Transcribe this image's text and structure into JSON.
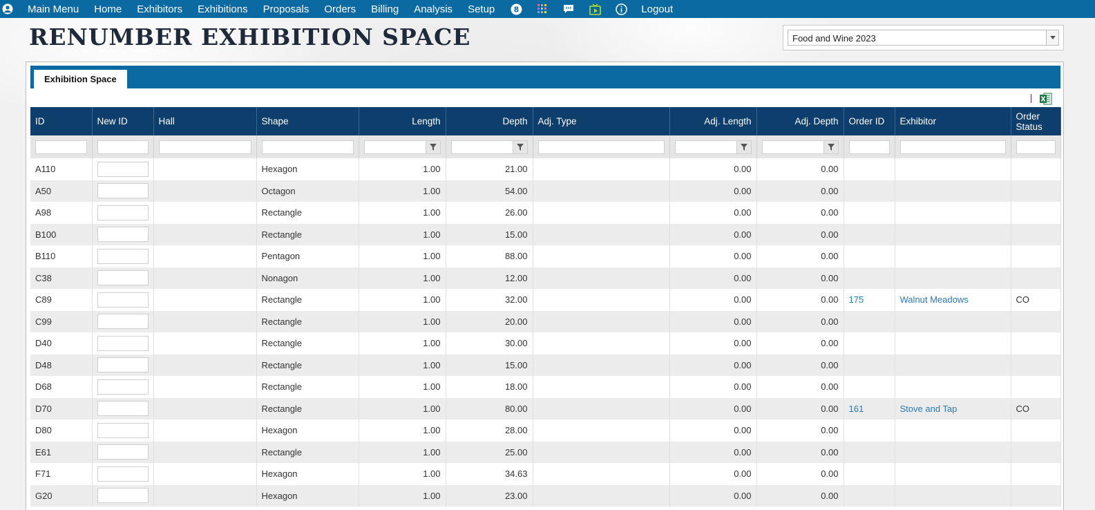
{
  "nav": {
    "items": [
      "Main Menu",
      "Home",
      "Exhibitors",
      "Exhibitions",
      "Proposals",
      "Orders",
      "Billing",
      "Analysis",
      "Setup"
    ],
    "badge": "8",
    "logout": "Logout"
  },
  "header": {
    "title": "RENUMBER EXHIBITION SPACE",
    "exhibition_selected": "Food and Wine 2023"
  },
  "tabs": [
    {
      "label": "Exhibition Space"
    }
  ],
  "grid": {
    "columns": [
      {
        "label": "ID"
      },
      {
        "label": "New ID"
      },
      {
        "label": "Hall"
      },
      {
        "label": "Shape"
      },
      {
        "label": "Length"
      },
      {
        "label": "Depth"
      },
      {
        "label": "Adj. Type"
      },
      {
        "label": "Adj. Length"
      },
      {
        "label": "Adj. Depth"
      },
      {
        "label": "Order ID"
      },
      {
        "label": "Exhibitor"
      },
      {
        "label": "Order Status"
      }
    ],
    "rows": [
      {
        "id": "A110",
        "hall": "",
        "shape": "Hexagon",
        "length": "1.00",
        "depth": "21.00",
        "adj_type": "",
        "adj_length": "0.00",
        "adj_depth": "0.00",
        "order_id": "",
        "exhibitor": "",
        "status": ""
      },
      {
        "id": "A50",
        "hall": "",
        "shape": "Octagon",
        "length": "1.00",
        "depth": "54.00",
        "adj_type": "",
        "adj_length": "0.00",
        "adj_depth": "0.00",
        "order_id": "",
        "exhibitor": "",
        "status": ""
      },
      {
        "id": "A98",
        "hall": "",
        "shape": "Rectangle",
        "length": "1.00",
        "depth": "26.00",
        "adj_type": "",
        "adj_length": "0.00",
        "adj_depth": "0.00",
        "order_id": "",
        "exhibitor": "",
        "status": ""
      },
      {
        "id": "B100",
        "hall": "",
        "shape": "Rectangle",
        "length": "1.00",
        "depth": "15.00",
        "adj_type": "",
        "adj_length": "0.00",
        "adj_depth": "0.00",
        "order_id": "",
        "exhibitor": "",
        "status": ""
      },
      {
        "id": "B110",
        "hall": "",
        "shape": "Pentagon",
        "length": "1.00",
        "depth": "88.00",
        "adj_type": "",
        "adj_length": "0.00",
        "adj_depth": "0.00",
        "order_id": "",
        "exhibitor": "",
        "status": ""
      },
      {
        "id": "C38",
        "hall": "",
        "shape": "Nonagon",
        "length": "1.00",
        "depth": "12.00",
        "adj_type": "",
        "adj_length": "0.00",
        "adj_depth": "0.00",
        "order_id": "",
        "exhibitor": "",
        "status": ""
      },
      {
        "id": "C89",
        "hall": "",
        "shape": "Rectangle",
        "length": "1.00",
        "depth": "32.00",
        "adj_type": "",
        "adj_length": "0.00",
        "adj_depth": "0.00",
        "order_id": "175",
        "exhibitor": "Walnut Meadows",
        "status": "CO"
      },
      {
        "id": "C99",
        "hall": "",
        "shape": "Rectangle",
        "length": "1.00",
        "depth": "20.00",
        "adj_type": "",
        "adj_length": "0.00",
        "adj_depth": "0.00",
        "order_id": "",
        "exhibitor": "",
        "status": ""
      },
      {
        "id": "D40",
        "hall": "",
        "shape": "Rectangle",
        "length": "1.00",
        "depth": "30.00",
        "adj_type": "",
        "adj_length": "0.00",
        "adj_depth": "0.00",
        "order_id": "",
        "exhibitor": "",
        "status": ""
      },
      {
        "id": "D48",
        "hall": "",
        "shape": "Rectangle",
        "length": "1.00",
        "depth": "15.00",
        "adj_type": "",
        "adj_length": "0.00",
        "adj_depth": "0.00",
        "order_id": "",
        "exhibitor": "",
        "status": ""
      },
      {
        "id": "D68",
        "hall": "",
        "shape": "Rectangle",
        "length": "1.00",
        "depth": "18.00",
        "adj_type": "",
        "adj_length": "0.00",
        "adj_depth": "0.00",
        "order_id": "",
        "exhibitor": "",
        "status": ""
      },
      {
        "id": "D70",
        "hall": "",
        "shape": "Rectangle",
        "length": "1.00",
        "depth": "80.00",
        "adj_type": "",
        "adj_length": "0.00",
        "adj_depth": "0.00",
        "order_id": "161",
        "exhibitor": "Stove and Tap",
        "status": "CO"
      },
      {
        "id": "D80",
        "hall": "",
        "shape": "Hexagon",
        "length": "1.00",
        "depth": "28.00",
        "adj_type": "",
        "adj_length": "0.00",
        "adj_depth": "0.00",
        "order_id": "",
        "exhibitor": "",
        "status": ""
      },
      {
        "id": "E61",
        "hall": "",
        "shape": "Rectangle",
        "length": "1.00",
        "depth": "25.00",
        "adj_type": "",
        "adj_length": "0.00",
        "adj_depth": "0.00",
        "order_id": "",
        "exhibitor": "",
        "status": ""
      },
      {
        "id": "F71",
        "hall": "",
        "shape": "Hexagon",
        "length": "1.00",
        "depth": "34.63",
        "adj_type": "",
        "adj_length": "0.00",
        "adj_depth": "0.00",
        "order_id": "",
        "exhibitor": "",
        "status": ""
      },
      {
        "id": "G20",
        "hall": "",
        "shape": "Hexagon",
        "length": "1.00",
        "depth": "23.00",
        "adj_type": "",
        "adj_length": "0.00",
        "adj_depth": "0.00",
        "order_id": "",
        "exhibitor": "",
        "status": ""
      }
    ]
  },
  "icons": {
    "user": "user-circle-icon",
    "badge": "badge-icon",
    "apps": "apps-grid-icon",
    "chat": "chat-icon",
    "tv": "tv-icon",
    "info": "info-icon",
    "excel": "excel-export-icon",
    "filter": "filter-icon"
  },
  "colors": {
    "nav_bg": "#0a6aa1",
    "grid_header": "#0e3e6b",
    "link": "#2a7ab8",
    "excel": "#1d7a45"
  }
}
